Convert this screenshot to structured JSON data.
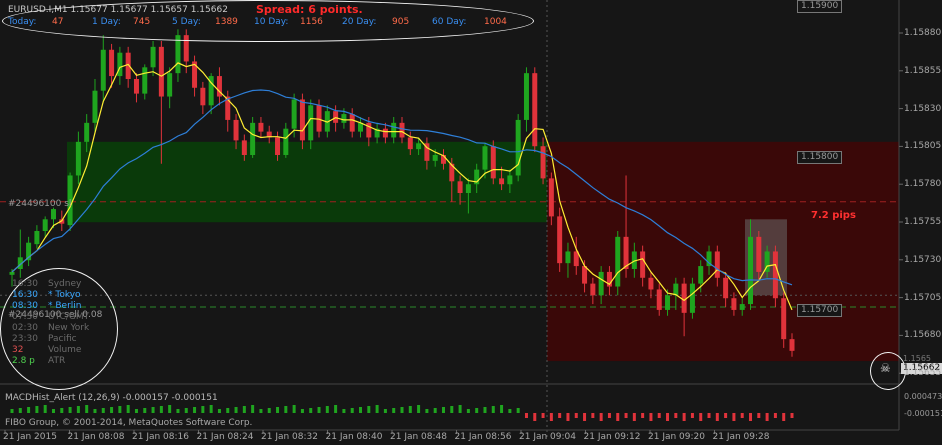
{
  "header": {
    "symbol_line": "EURUSD.I,M1  1.15677 1.15677 1.15657 1.15662",
    "spread": "Spread: 6 points.",
    "stats": [
      {
        "label": "Today:",
        "value": "47"
      },
      {
        "label": "1 Day:",
        "value": "745"
      },
      {
        "label": "5 Day:",
        "value": "1389"
      },
      {
        "label": "10 Day:",
        "value": "1156"
      },
      {
        "label": "20 Day:",
        "value": "905"
      },
      {
        "label": "60 Day:",
        "value": "1004"
      }
    ]
  },
  "price_axis": {
    "ticks": [
      "1.15880",
      "1.15855",
      "1.15830",
      "1.15805",
      "1.15780",
      "1.15755",
      "1.15730",
      "1.15705",
      "1.15680",
      "1.15655"
    ],
    "current_price": "1.15662",
    "marker_top": "1.15900",
    "marker_tp": "1.15800",
    "marker_sl": "1.15700",
    "partial_label": "1.1565"
  },
  "time_axis": {
    "ticks": [
      "21 Jan 2015",
      "21 Jan 08:08",
      "21 Jan 08:16",
      "21 Jan 08:24",
      "21 Jan 08:32",
      "21 Jan 08:40",
      "21 Jan 08:48",
      "21 Jan 08:56",
      "21 Jan 09:04",
      "21 Jan 09:12",
      "21 Jan 09:20",
      "21 Jan 09:28"
    ]
  },
  "trade": {
    "buy_label": "#24496100 sl",
    "sell_label": "#24496100 sell 0.08",
    "pips_label": "7.2 pips"
  },
  "sessions": [
    {
      "time": "16:30",
      "city": "Sydney"
    },
    {
      "time": "16:30",
      "city": "* Tokyo"
    },
    {
      "time": "08:30",
      "city": "* Berlin"
    },
    {
      "time": "07:30",
      "city": "UTC/GMT"
    },
    {
      "time": "02:30",
      "city": "New York"
    },
    {
      "time": "23:30",
      "city": "Pacific"
    },
    {
      "time": "32",
      "city": "Volume"
    },
    {
      "time": "2.8 p",
      "city": "ATR"
    }
  ],
  "indicator": {
    "label": "MACDHist_Alert (12,26,9)  -0.000157 -0.000151",
    "scale_top": "0.000473",
    "scale_bottom": "-0.000151"
  },
  "footer": {
    "copyright": "FIBO Group, © 2001-2014, MetaQuotes Software Corp."
  },
  "colors": {
    "bull": "#1fa51f",
    "bear": "#e0333b",
    "fast_ma": "#ffee33",
    "slow_ma": "#2e7fd8",
    "buy_zone": "#0a3a0a",
    "sell_zone": "#3a0808"
  },
  "chart_data": {
    "type": "candlestick",
    "symbol": "EURUSD.I",
    "timeframe": "M1",
    "y_range": [
      1.1564,
      1.159
    ],
    "candles": [
      [
        1.15714,
        1.15716,
        1.15706,
        1.15718
      ],
      [
        1.15718,
        1.15726,
        1.15712,
        1.15745
      ],
      [
        1.15724,
        1.15736,
        1.1572,
        1.1574
      ],
      [
        1.15735,
        1.15744,
        1.15732,
        1.15748
      ],
      [
        1.15744,
        1.15752,
        1.1574,
        1.15754
      ],
      [
        1.15752,
        1.15759,
        1.15746,
        1.1576
      ],
      [
        1.15752,
        1.15749,
        1.15744,
        1.15758
      ],
      [
        1.15748,
        1.15782,
        1.15744,
        1.15784
      ],
      [
        1.15782,
        1.15805,
        1.15776,
        1.15812
      ],
      [
        1.15805,
        1.15818,
        1.15798,
        1.15824
      ],
      [
        1.15818,
        1.1584,
        1.15812,
        1.15848
      ],
      [
        1.1584,
        1.15868,
        1.15832,
        1.15878
      ],
      [
        1.15868,
        1.1585,
        1.15842,
        1.15872
      ],
      [
        1.1585,
        1.15866,
        1.15844,
        1.1587
      ],
      [
        1.15866,
        1.15848,
        1.15842,
        1.1587
      ],
      [
        1.15848,
        1.15838,
        1.15832,
        1.15852
      ],
      [
        1.15838,
        1.15856,
        1.15834,
        1.15858
      ],
      [
        1.15856,
        1.1587,
        1.1585,
        1.15874
      ],
      [
        1.1587,
        1.15836,
        1.1579,
        1.15874
      ],
      [
        1.15836,
        1.15852,
        1.15828,
        1.15856
      ],
      [
        1.15852,
        1.15878,
        1.15846,
        1.15882
      ],
      [
        1.15878,
        1.1586,
        1.15852,
        1.15882
      ],
      [
        1.1586,
        1.15842,
        1.15836,
        1.15864
      ],
      [
        1.15842,
        1.1583,
        1.15824,
        1.15846
      ],
      [
        1.1583,
        1.1585,
        1.15824,
        1.15852
      ],
      [
        1.1585,
        1.15836,
        1.1583,
        1.15856
      ],
      [
        1.15836,
        1.1582,
        1.15812,
        1.1584
      ],
      [
        1.1582,
        1.15806,
        1.158,
        1.15824
      ],
      [
        1.15806,
        1.15796,
        1.15792,
        1.1581
      ],
      [
        1.15796,
        1.15818,
        1.15794,
        1.15822
      ],
      [
        1.15818,
        1.15812,
        1.15808,
        1.15822
      ],
      [
        1.15812,
        1.15808,
        1.15804,
        1.15816
      ],
      [
        1.15808,
        1.15796,
        1.15792,
        1.15812
      ],
      [
        1.15796,
        1.15814,
        1.15794,
        1.15818
      ],
      [
        1.15814,
        1.15834,
        1.15808,
        1.15838
      ],
      [
        1.15834,
        1.15806,
        1.158,
        1.15838
      ],
      [
        1.15806,
        1.1583,
        1.158,
        1.15834
      ],
      [
        1.1583,
        1.15812,
        1.15808,
        1.15834
      ],
      [
        1.15812,
        1.15826,
        1.15808,
        1.1583
      ],
      [
        1.15826,
        1.15818,
        1.15812,
        1.1583
      ],
      [
        1.15818,
        1.15824,
        1.15814,
        1.15828
      ],
      [
        1.15824,
        1.15812,
        1.15808,
        1.15828
      ],
      [
        1.15812,
        1.15818,
        1.15808,
        1.15822
      ],
      [
        1.15818,
        1.15808,
        1.15802,
        1.15822
      ],
      [
        1.15808,
        1.15814,
        1.15804,
        1.15818
      ],
      [
        1.15814,
        1.15808,
        1.15804,
        1.15818
      ],
      [
        1.15808,
        1.15818,
        1.15804,
        1.15822
      ],
      [
        1.15818,
        1.15808,
        1.15804,
        1.15822
      ],
      [
        1.15808,
        1.158,
        1.15796,
        1.15812
      ],
      [
        1.158,
        1.15804,
        1.15796,
        1.15808
      ],
      [
        1.15804,
        1.15792,
        1.15786,
        1.15808
      ],
      [
        1.15792,
        1.15796,
        1.15788,
        1.158
      ],
      [
        1.15796,
        1.1579,
        1.15786,
        1.158
      ],
      [
        1.1579,
        1.15778,
        1.15764,
        1.15794
      ],
      [
        1.15778,
        1.1577,
        1.15762,
        1.15782
      ],
      [
        1.1577,
        1.15776,
        1.15756,
        1.1578
      ],
      [
        1.15776,
        1.15786,
        1.1577,
        1.1579
      ],
      [
        1.15786,
        1.15802,
        1.1578,
        1.15804
      ],
      [
        1.15802,
        1.1578,
        1.15776,
        1.15806
      ],
      [
        1.1578,
        1.15776,
        1.15772,
        1.15788
      ],
      [
        1.15776,
        1.15782,
        1.1577,
        1.15786
      ],
      [
        1.15782,
        1.1582,
        1.15778,
        1.15824
      ],
      [
        1.1582,
        1.15852,
        1.15812,
        1.15856
      ],
      [
        1.15852,
        1.15802,
        1.15798,
        1.15856
      ],
      [
        1.15802,
        1.1578,
        1.15776,
        1.15808
      ],
      [
        1.1578,
        1.15754,
        1.15748,
        1.15784
      ],
      [
        1.15754,
        1.15722,
        1.15716,
        1.1576
      ],
      [
        1.15722,
        1.1573,
        1.15712,
        1.15736
      ],
      [
        1.1573,
        1.1572,
        1.15714,
        1.1574
      ],
      [
        1.1572,
        1.15708,
        1.15702,
        1.15724
      ],
      [
        1.15708,
        1.157,
        1.15694,
        1.15712
      ],
      [
        1.157,
        1.15716,
        1.15694,
        1.1572
      ],
      [
        1.15716,
        1.15706,
        1.157,
        1.1572
      ],
      [
        1.15706,
        1.1574,
        1.157,
        1.15744
      ],
      [
        1.1574,
        1.15718,
        1.15712,
        1.15782
      ],
      [
        1.15718,
        1.1573,
        1.15712,
        1.15736
      ],
      [
        1.1573,
        1.15712,
        1.15706,
        1.15734
      ],
      [
        1.15712,
        1.15704,
        1.15698,
        1.15716
      ],
      [
        1.15704,
        1.1569,
        1.15686,
        1.15708
      ],
      [
        1.1569,
        1.157,
        1.15686,
        1.15704
      ],
      [
        1.157,
        1.15708,
        1.1569,
        1.15712
      ],
      [
        1.15708,
        1.15688,
        1.15672,
        1.15712
      ],
      [
        1.15688,
        1.15708,
        1.15684,
        1.15712
      ],
      [
        1.15708,
        1.1572,
        1.15702,
        1.15724
      ],
      [
        1.1572,
        1.1573,
        1.15714,
        1.15734
      ],
      [
        1.1573,
        1.15712,
        1.15706,
        1.15734
      ],
      [
        1.15712,
        1.15698,
        1.15692,
        1.15716
      ],
      [
        1.15698,
        1.1569,
        1.15686,
        1.15702
      ],
      [
        1.1569,
        1.15694,
        1.15686,
        1.15698
      ],
      [
        1.15694,
        1.1574,
        1.1569,
        1.15752
      ],
      [
        1.1574,
        1.15716,
        1.1571,
        1.15744
      ],
      [
        1.15716,
        1.1573,
        1.15712,
        1.15734
      ],
      [
        1.1573,
        1.15698,
        1.15692,
        1.15734
      ],
      [
        1.15698,
        1.1567,
        1.15664,
        1.15702
      ],
      [
        1.1567,
        1.15662,
        1.15658,
        1.15674
      ]
    ]
  }
}
